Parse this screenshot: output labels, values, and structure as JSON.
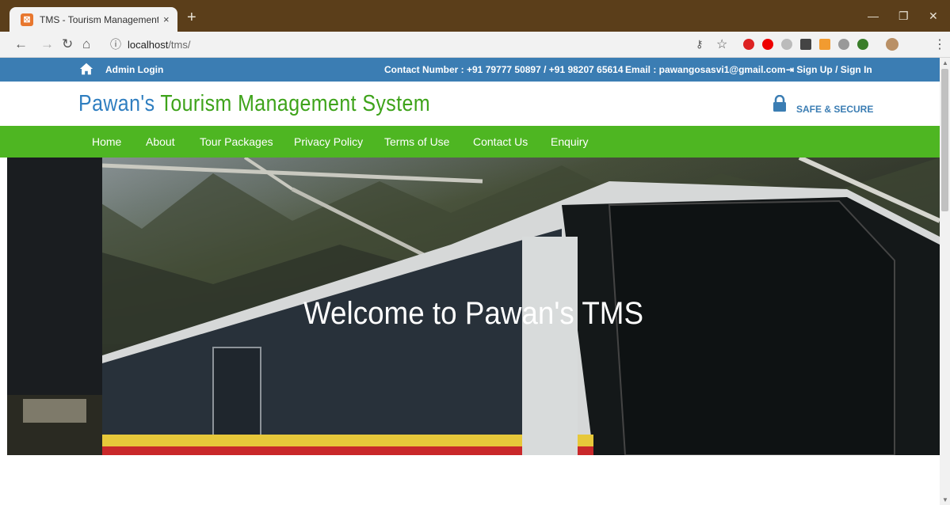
{
  "browser": {
    "tab_title": "TMS - Tourism Management Syst",
    "tab_close": "×",
    "new_tab": "+",
    "url_host": "localhost",
    "url_path": "/tms/",
    "window_controls": [
      "—",
      "❐",
      "✕"
    ]
  },
  "topbar": {
    "admin_login": "Admin Login",
    "contact": "Contact Number : +91 79777 50897 / +91 98207 65614",
    "email": "Email : pawangosasvi1@gmail.com",
    "signin": "Sign Up / Sign In",
    "bg_color": "#3b7db3"
  },
  "header": {
    "logo_part1": "Pawan's",
    "logo_part2": "Tourism Management System",
    "safe_secure": "SAFE & SECURE"
  },
  "nav": {
    "items": [
      "Home",
      "About",
      "Tour Packages",
      "Privacy Policy",
      "Terms of Use",
      "Contact Us",
      "Enquiry"
    ],
    "bg_color": "#4eb622"
  },
  "hero": {
    "title": "Welcome to Pawan's TMS"
  },
  "icons": {
    "home": "home-icon",
    "lock": "lock-icon",
    "signin": "sign-in-icon"
  }
}
